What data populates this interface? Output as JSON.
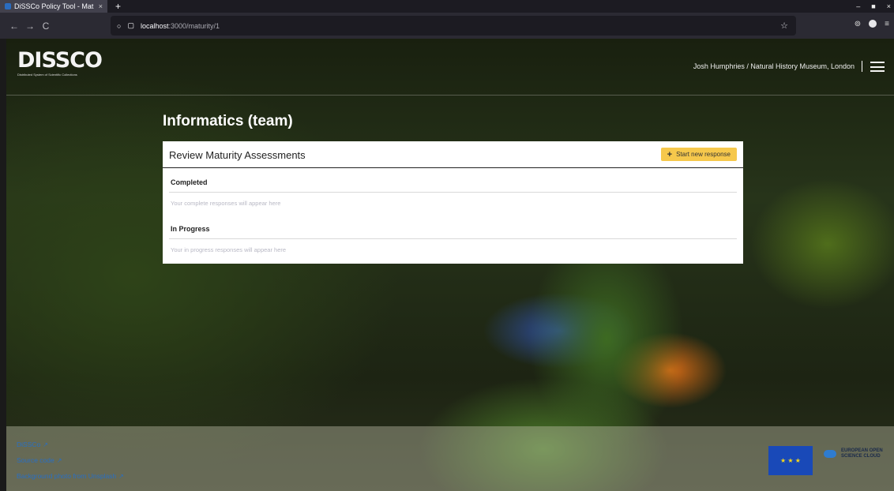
{
  "browser": {
    "tab_title": "DiSSCo Policy Tool - Mat",
    "tab_close": "×",
    "new_tab": "+",
    "url_host": "localhost",
    "url_path": ":3000/maturity/1",
    "win_min": "–",
    "win_max": "■",
    "win_close": "×",
    "back": "←",
    "forward": "→",
    "reload": "C",
    "shield": "○",
    "page": "▢",
    "star": "☆",
    "pocket": "⊚",
    "menu": "≡"
  },
  "header": {
    "logo_text": "DISSCO",
    "logo_tagline": "Distributed System of Scientific Collections",
    "user_info": "Josh Humphries / Natural History Museum, London"
  },
  "main": {
    "heading": "Informatics (team)",
    "card_title": "Review Maturity Assessments",
    "start_button": "Start new response",
    "start_button_icon": "+",
    "completed_title": "Completed",
    "completed_placeholder": "Your complete responses will appear here",
    "in_progress_title": "In Progress",
    "in_progress_placeholder": "Your in progress responses will appear here"
  },
  "footer": {
    "links": [
      "DiSSCo",
      "Source code",
      "Background photo from Unsplash"
    ],
    "ext_icon": "↗",
    "eu_stars": "★ ★ ★",
    "eosc_line1": "EUROPEAN OPEN",
    "eosc_line2": "SCIENCE CLOUD"
  },
  "colors": {
    "accent_button": "#f6c84c",
    "link": "#2a6fc2"
  },
  "icons": [
    "shield-icon",
    "page-icon",
    "star-icon",
    "hamburger-icon",
    "external-link-icon",
    "plus-icon"
  ]
}
